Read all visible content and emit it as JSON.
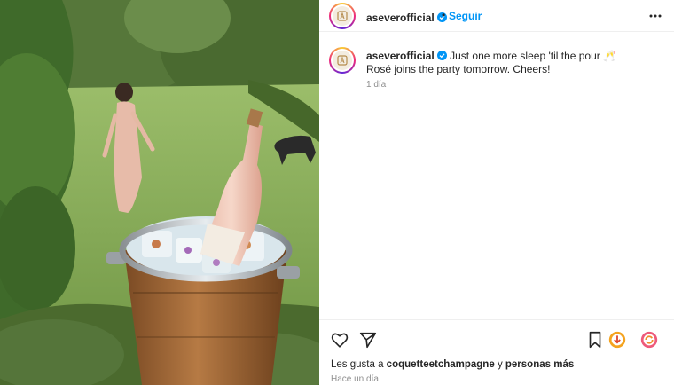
{
  "post": {
    "image_alt": "Rosé bottle in ice bucket on garden lawn"
  },
  "header": {
    "username": "aseverofficial",
    "separator": "•",
    "follow_label": "Seguir",
    "more_icon": "more-horizontal-icon"
  },
  "caption": {
    "username": "aseverofficial",
    "line1": "Just one more sleep 'til the pour",
    "line2": "Rosé joins the party tomorrow. Cheers!",
    "emoji": "🥂",
    "time": "1 día"
  },
  "actions": {
    "like_icon": "heart-icon",
    "share_icon": "send-icon",
    "save_icon": "bookmark-icon"
  },
  "likes": {
    "prefix": "Les gusta a",
    "user": "coquetteetchampagne",
    "middle": "y",
    "others": "personas más"
  },
  "posted": "Hace un día",
  "colors": {
    "link": "#0095f6",
    "verified": "#0095f6",
    "muted": "#8e8e8e"
  }
}
